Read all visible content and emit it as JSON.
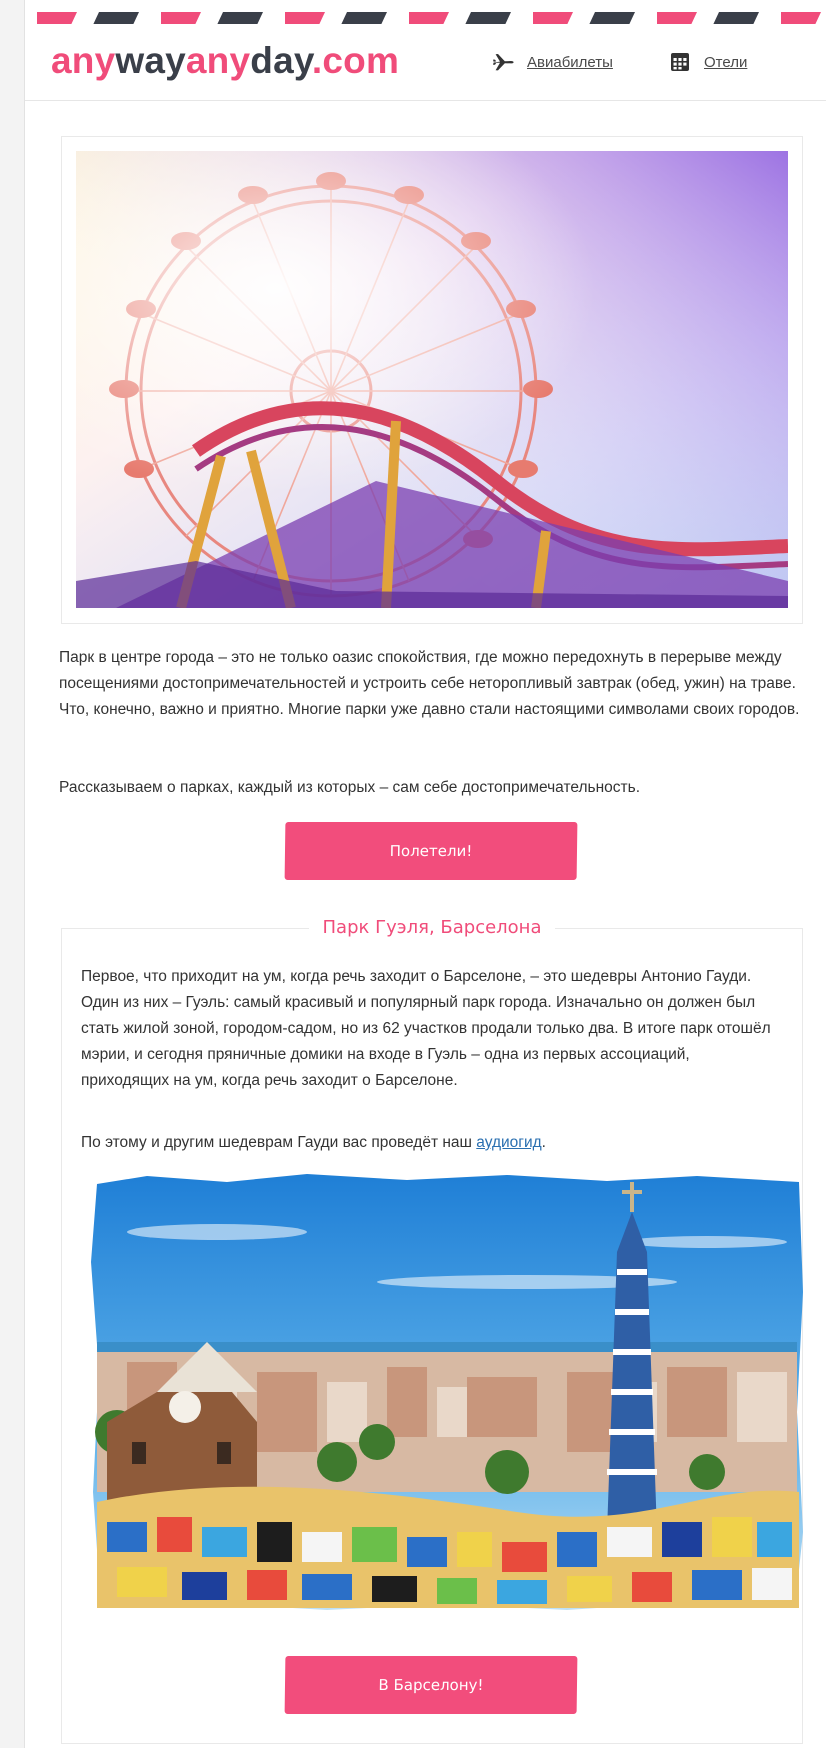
{
  "brand": {
    "logo_parts": [
      "any",
      "way",
      "any",
      "day",
      ".com"
    ],
    "pink": "#f04c7a",
    "dark": "#3a3f49"
  },
  "nav": {
    "flights": {
      "label": "Авиабилеты",
      "icon": "airplane-icon"
    },
    "hotels": {
      "label": "Отели",
      "icon": "hotel-calendar-icon"
    }
  },
  "intro": {
    "paragraph_1": "Парк в центре города – это не только оазис спокойствия, где можно передохнуть в перерыве между посещениями достопримечательностей и устроить себе неторопливый завтрак (обед, ужин) на траве. Что, конечно, важно и приятно. Многие парки уже давно стали настоящими символами своих городов.",
    "paragraph_2": "Рассказываем о парках, каждый из которых – сам себе достопримечательность.",
    "button_label": "Полетели!"
  },
  "park": {
    "title": "Парк Гуэля, Барселона",
    "paragraph_1": "Первое, что приходит на ум, когда речь заходит о Барселоне, – это шедевры Антонио Гауди. Один из них – Гуэль: самый красивый и популярный парк города. Изначально он должен был стать жилой зоной, городом-садом, но из 62 участков продали только два. В итоге парк отошёл мэрии, и сегодня пряничные домики на входе в Гуэль – одна из первых ассоциаций, приходящих на ум, когда речь заходит о Барселоне.",
    "paragraph_2_prefix": "По этому и другим шедеврам Гауди вас проведёт наш ",
    "paragraph_2_link": "аудиогид",
    "paragraph_2_suffix": ".",
    "button_label": "В Барселону!"
  },
  "colors": {
    "accent": "#f24d7c",
    "link": "#2a6fb0"
  }
}
